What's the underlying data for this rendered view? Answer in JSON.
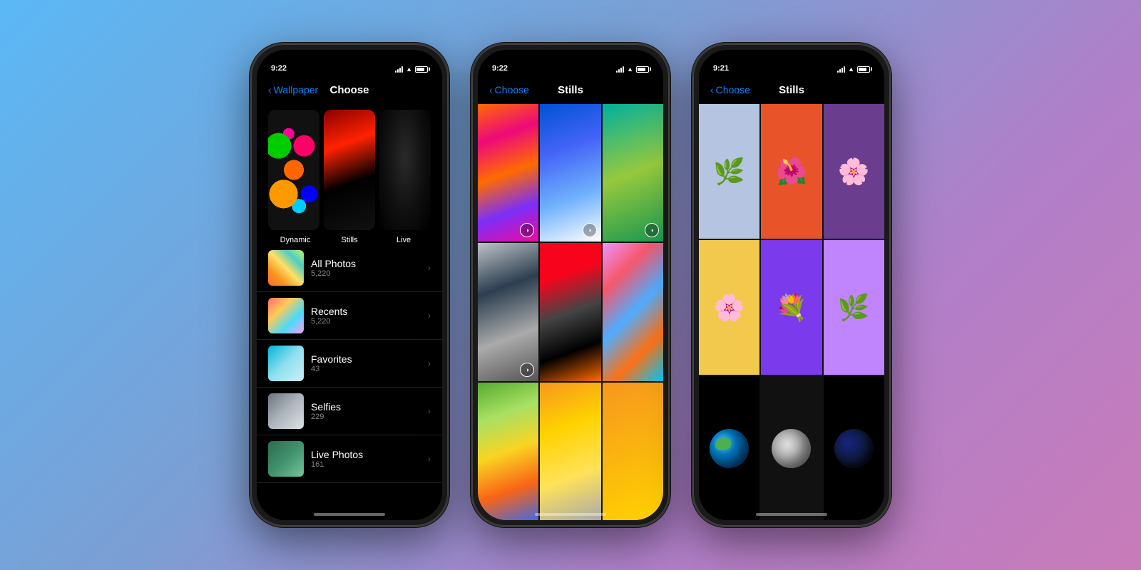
{
  "background": {
    "gradient": "linear-gradient(135deg, #5bb8f5 0%, #7b9fd4 40%, #b07fc9 70%, #c97bb8 100%)"
  },
  "phone1": {
    "time": "9:22",
    "nav_back": "Wallpaper",
    "nav_title": "Choose",
    "categories": [
      "Dynamic",
      "Stills",
      "Live"
    ],
    "library_items": [
      {
        "name": "All Photos",
        "count": "5,220",
        "thumb": "all"
      },
      {
        "name": "Recents",
        "count": "5,220",
        "thumb": "recents"
      },
      {
        "name": "Favorites",
        "count": "43",
        "thumb": "favorites"
      },
      {
        "name": "Selfies",
        "count": "229",
        "thumb": "selfies"
      },
      {
        "name": "Live Photos",
        "count": "161",
        "thumb": "live"
      }
    ]
  },
  "phone2": {
    "time": "9:22",
    "nav_back": "Choose",
    "nav_title": "Stills"
  },
  "phone3": {
    "time": "9:21",
    "nav_back": "Choose",
    "nav_title": "Stills"
  }
}
